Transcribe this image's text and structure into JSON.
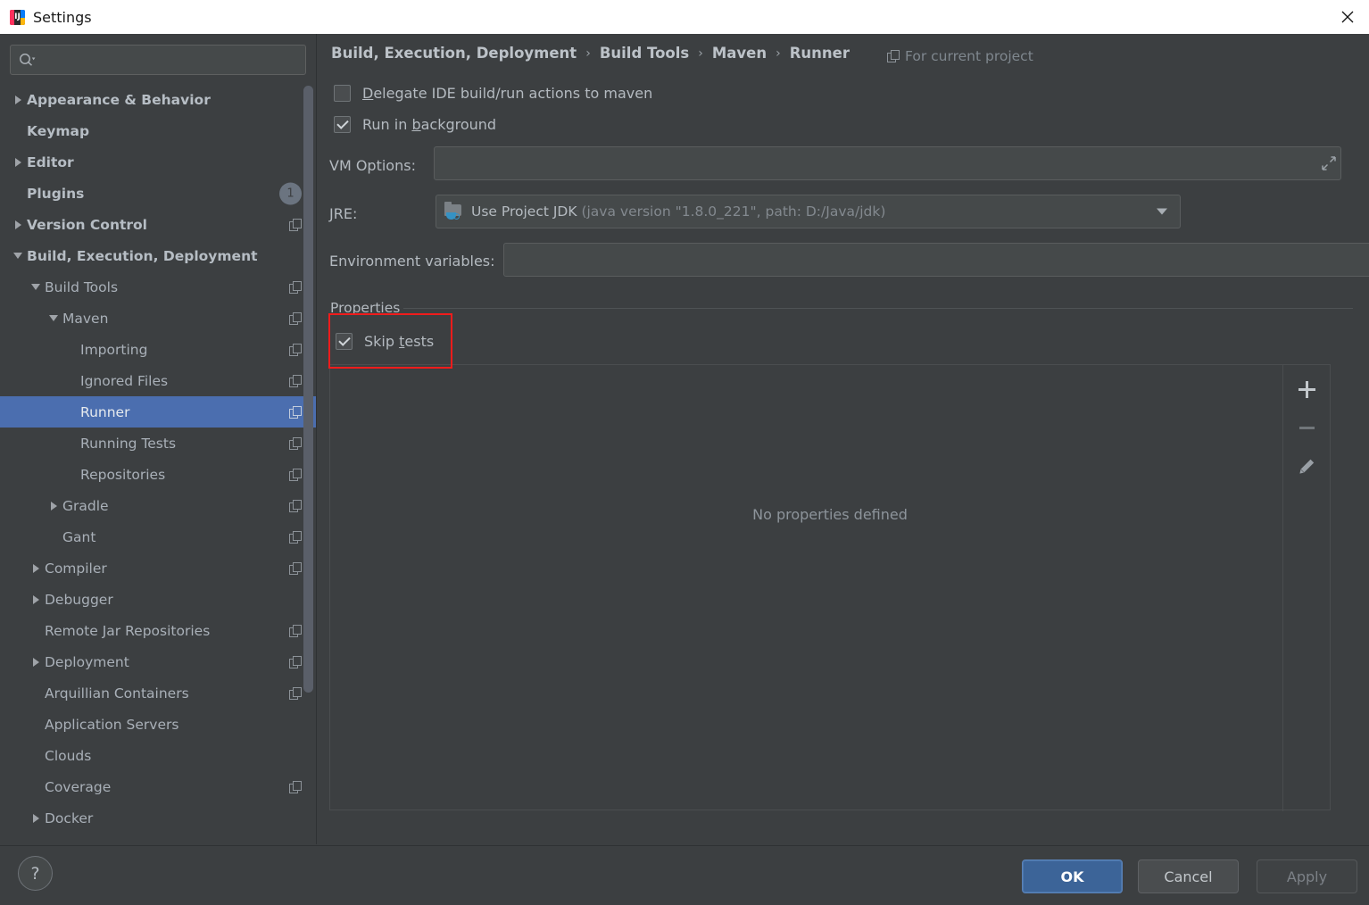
{
  "window": {
    "title": "Settings",
    "app_icon": "intellij-idea-icon",
    "close_icon": "close-icon"
  },
  "search": {
    "value": "",
    "placeholder": "",
    "icon": "search-icon"
  },
  "sidebar": {
    "items": [
      {
        "label": "Appearance & Behavior",
        "level": 0,
        "arrow": "right",
        "badge": null,
        "copy": false,
        "selected": false
      },
      {
        "label": "Keymap",
        "level": 0,
        "arrow": "none",
        "badge": null,
        "copy": false,
        "selected": false
      },
      {
        "label": "Editor",
        "level": 0,
        "arrow": "right",
        "badge": null,
        "copy": false,
        "selected": false
      },
      {
        "label": "Plugins",
        "level": 0,
        "arrow": "none",
        "badge": "1",
        "copy": false,
        "selected": false
      },
      {
        "label": "Version Control",
        "level": 0,
        "arrow": "right",
        "badge": null,
        "copy": true,
        "selected": false
      },
      {
        "label": "Build, Execution, Deployment",
        "level": 0,
        "arrow": "down",
        "badge": null,
        "copy": false,
        "selected": false
      },
      {
        "label": "Build Tools",
        "level": 1,
        "arrow": "down",
        "badge": null,
        "copy": true,
        "selected": false
      },
      {
        "label": "Maven",
        "level": 2,
        "arrow": "down",
        "badge": null,
        "copy": true,
        "selected": false
      },
      {
        "label": "Importing",
        "level": 3,
        "arrow": "none",
        "badge": null,
        "copy": true,
        "selected": false
      },
      {
        "label": "Ignored Files",
        "level": 3,
        "arrow": "none",
        "badge": null,
        "copy": true,
        "selected": false
      },
      {
        "label": "Runner",
        "level": 3,
        "arrow": "none",
        "badge": null,
        "copy": true,
        "selected": true
      },
      {
        "label": "Running Tests",
        "level": 3,
        "arrow": "none",
        "badge": null,
        "copy": true,
        "selected": false
      },
      {
        "label": "Repositories",
        "level": 3,
        "arrow": "none",
        "badge": null,
        "copy": true,
        "selected": false
      },
      {
        "label": "Gradle",
        "level": 2,
        "arrow": "right",
        "badge": null,
        "copy": true,
        "selected": false
      },
      {
        "label": "Gant",
        "level": 2,
        "arrow": "none",
        "badge": null,
        "copy": true,
        "selected": false
      },
      {
        "label": "Compiler",
        "level": 1,
        "arrow": "right",
        "badge": null,
        "copy": true,
        "selected": false
      },
      {
        "label": "Debugger",
        "level": 1,
        "arrow": "right",
        "badge": null,
        "copy": false,
        "selected": false
      },
      {
        "label": "Remote Jar Repositories",
        "level": 1,
        "arrow": "none",
        "badge": null,
        "copy": true,
        "selected": false
      },
      {
        "label": "Deployment",
        "level": 1,
        "arrow": "right",
        "badge": null,
        "copy": true,
        "selected": false
      },
      {
        "label": "Arquillian Containers",
        "level": 1,
        "arrow": "none",
        "badge": null,
        "copy": true,
        "selected": false
      },
      {
        "label": "Application Servers",
        "level": 1,
        "arrow": "none",
        "badge": null,
        "copy": false,
        "selected": false
      },
      {
        "label": "Clouds",
        "level": 1,
        "arrow": "none",
        "badge": null,
        "copy": false,
        "selected": false
      },
      {
        "label": "Coverage",
        "level": 1,
        "arrow": "none",
        "badge": null,
        "copy": true,
        "selected": false
      },
      {
        "label": "Docker",
        "level": 1,
        "arrow": "right",
        "badge": null,
        "copy": false,
        "selected": false
      }
    ]
  },
  "main": {
    "breadcrumb": [
      "Build, Execution, Deployment",
      "Build Tools",
      "Maven",
      "Runner"
    ],
    "breadcrumb_separator": "›",
    "scope": {
      "label": "For current project",
      "icon": "project-scope-icon"
    },
    "options": {
      "delegate": {
        "label_before": "",
        "mnemonic": "D",
        "label_after": "elegate IDE build/run actions to maven",
        "checked": false
      },
      "run_background": {
        "label_before": "Run in ",
        "mnemonic": "b",
        "label_after": "ackground",
        "checked": true
      }
    },
    "vm_options": {
      "label": "VM Options:",
      "value": "",
      "expand_icon": "expand-icon"
    },
    "jre": {
      "label": "JRE:",
      "icon": "jdk-folder-icon",
      "value_main": "Use Project JDK",
      "value_detail": "(java version \"1.8.0_221\", path: D:/Java/jdk)",
      "arrow_icon": "chevron-down-icon"
    },
    "env_vars": {
      "label": "Environment variables:",
      "value": "",
      "browse_icon": "browse-list-icon"
    },
    "properties": {
      "group_title": "Properties",
      "skip_tests": {
        "label_before": "Skip ",
        "mnemonic": "t",
        "label_after": "ests",
        "checked": true
      },
      "empty_text": "No properties defined",
      "toolbar": [
        {
          "name": "add-property-button",
          "icon": "plus-icon",
          "enabled": true
        },
        {
          "name": "remove-property-button",
          "icon": "minus-icon",
          "enabled": false
        },
        {
          "name": "edit-property-button",
          "icon": "pencil-icon",
          "enabled": true
        }
      ]
    },
    "annotation_color": "#f01c1c"
  },
  "footer": {
    "help_label": "?",
    "ok_label": "OK",
    "cancel_label": "Cancel",
    "apply_label": "Apply"
  },
  "colors": {
    "panel_bg": "#3c3f41",
    "titlebar_bg": "#ffffff",
    "selection_blue": "#4b6eaf",
    "ok_button_blue": "#3c6498",
    "text_primary": "#b4bac0",
    "text_dim": "#83898f",
    "annotation_red": "#f01c1c"
  }
}
